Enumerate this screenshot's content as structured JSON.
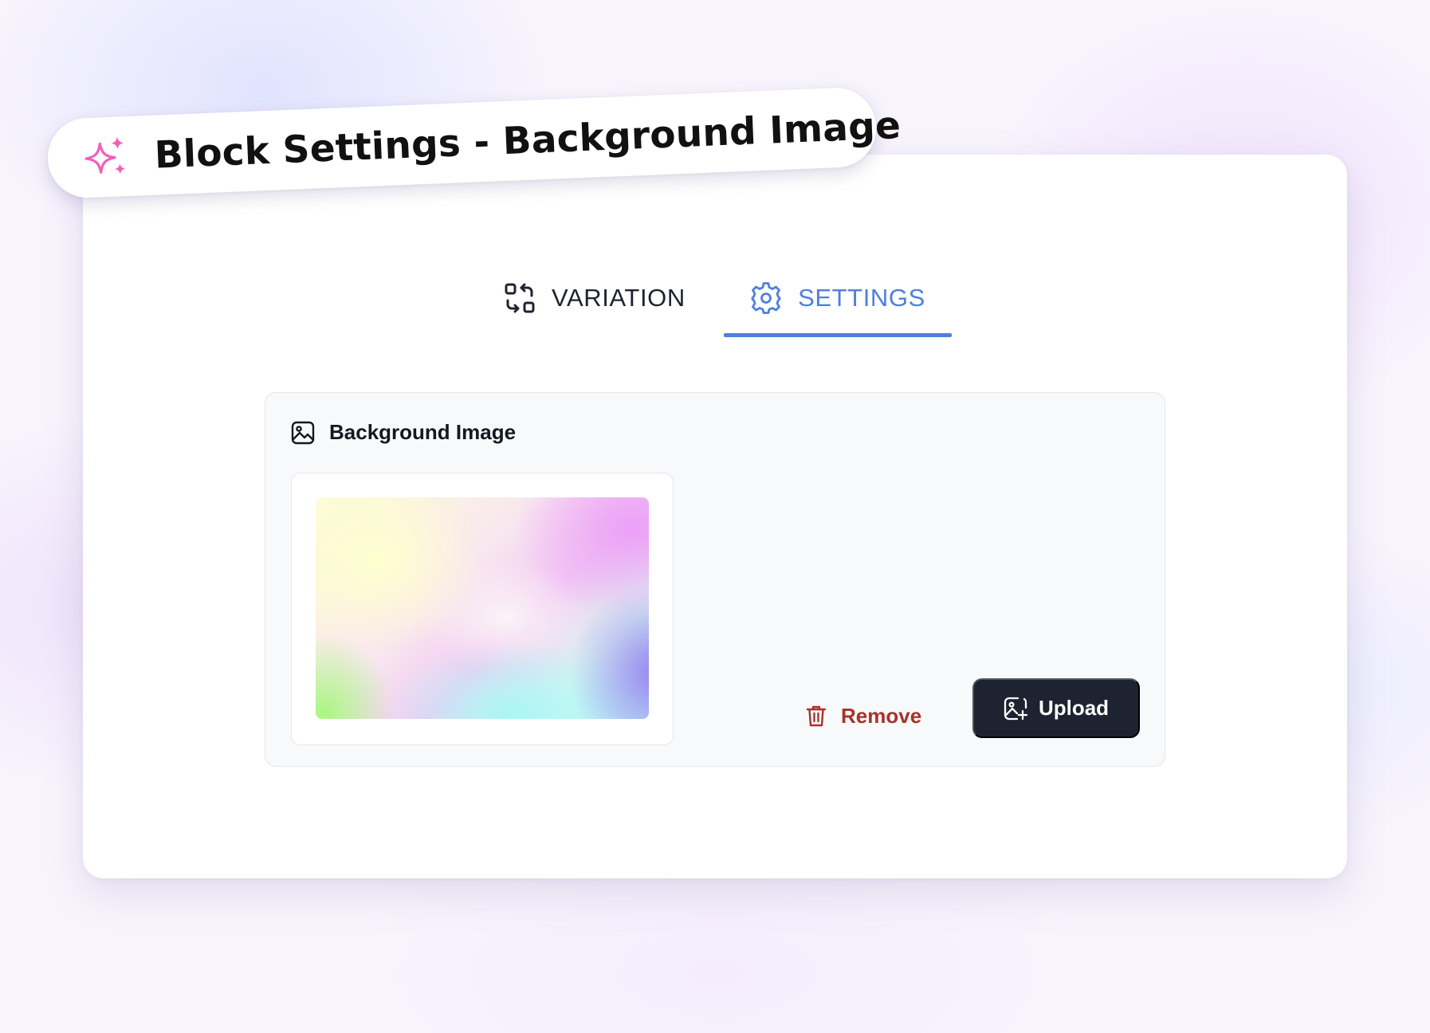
{
  "header": {
    "title": "Block Settings - Background Image",
    "icon": "sparkles-icon",
    "icon_color": "#f060b8"
  },
  "tabs": [
    {
      "label": "VARIATION",
      "icon": "swap-icon",
      "active": false
    },
    {
      "label": "SETTINGS",
      "icon": "gear-icon",
      "active": true
    }
  ],
  "colors": {
    "accent": "#4e7fe0",
    "danger": "#a8322c",
    "primary_button": "#1d2330"
  },
  "panel": {
    "label": "Background Image",
    "icon": "image-icon"
  },
  "actions": {
    "remove_label": "Remove",
    "remove_icon": "trash-icon",
    "upload_label": "Upload",
    "upload_icon": "image-add-icon"
  }
}
